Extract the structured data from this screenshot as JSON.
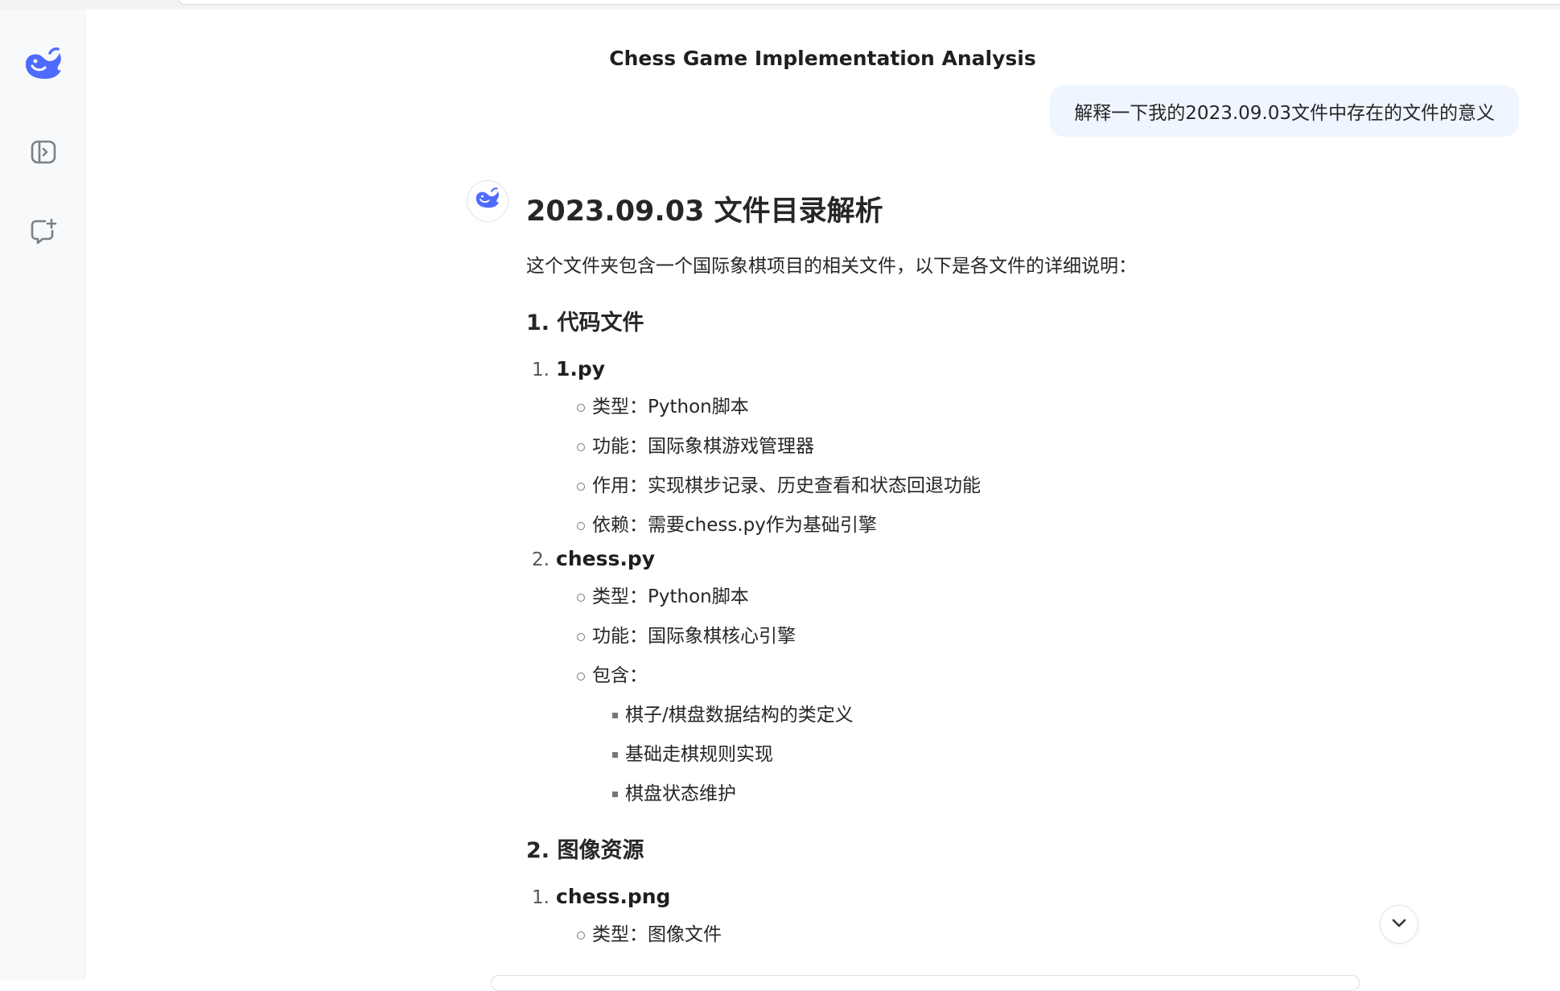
{
  "app": {
    "accent_color": "#4d6bfe"
  },
  "sidebar": {
    "logo_icon": "deepseek-whale-icon",
    "buttons": [
      {
        "icon": "sidebar-expand-icon"
      },
      {
        "icon": "new-chat-icon"
      }
    ]
  },
  "chat": {
    "title": "Chess Game Implementation Analysis",
    "user_message": "解释一下我的2023.09.03文件中存在的文件的意义"
  },
  "answer": {
    "heading": "2023.09.03 文件目录解析",
    "intro": "这个文件夹包含一个国际象棋项目的相关文件，以下是各文件的详细说明：",
    "sections": [
      {
        "title": "1. 代码文件",
        "items": [
          {
            "num": "1.",
            "name": "1.py",
            "bullets": [
              "类型：Python脚本",
              "功能：国际象棋游戏管理器",
              "作用：实现棋步记录、历史查看和状态回退功能",
              "依赖：需要chess.py作为基础引擎"
            ]
          },
          {
            "num": "2.",
            "name": "chess.py",
            "bullets": [
              "类型：Python脚本",
              "功能：国际象棋核心引擎",
              "包含："
            ],
            "sub_bullets": [
              "棋子/棋盘数据结构的类定义",
              "基础走棋规则实现",
              "棋盘状态维护"
            ]
          }
        ]
      },
      {
        "title": "2. 图像资源",
        "items": [
          {
            "num": "1.",
            "name": "chess.png",
            "bullets": [
              "类型：图像文件"
            ]
          }
        ]
      }
    ]
  },
  "scroll_button": {
    "icon": "chevron-down-icon"
  }
}
